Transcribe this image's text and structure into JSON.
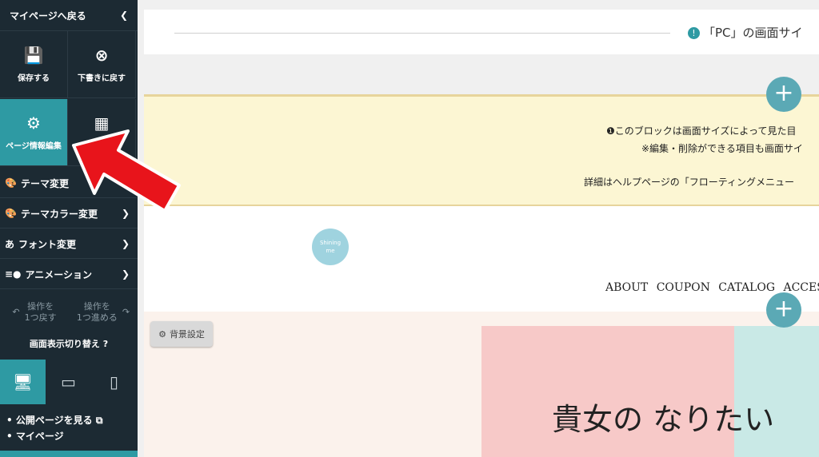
{
  "sidebar": {
    "back_label": "マイページへ戻る",
    "collapse_icon": "chevron-left-icon",
    "save_label": "保存する",
    "revert_label": "下書きに戻す",
    "page_edit_label": "ページ情報編集",
    "calc_label": "表",
    "theme_label": "テーマ変更",
    "theme_color_label": "テーマカラー変更",
    "font_label": "フォント変更",
    "animation_label": "アニメーション",
    "undo_label_1": "操作を",
    "undo_label_2": "1つ戻す",
    "redo_label_1": "操作を",
    "redo_label_2": "1つ進める",
    "display_title": "画面表示切り替え",
    "view_public_label": "公開ページを見る",
    "mypage_label": "マイページ"
  },
  "topbar": {
    "message": "「PC」の画面サイ"
  },
  "notice": {
    "line1": "このブロックは画面サイズによって見た目",
    "line2": "※編集・削除ができる項目も画面サイ",
    "line3": "詳細はヘルプページの「フローティングメニュー"
  },
  "logo": {
    "text1": "Shining",
    "text2": "me"
  },
  "nav": {
    "items": "ABOUT COUPON CATALOG ACCES"
  },
  "hero": {
    "bg_button": "背景設定",
    "text": "貴女の なりたい"
  },
  "colors": {
    "accent": "#2e9aa3",
    "sidebar_bg": "#1c2a33",
    "notice_bg": "#fcf6d3",
    "arrow": "#e8141b"
  }
}
